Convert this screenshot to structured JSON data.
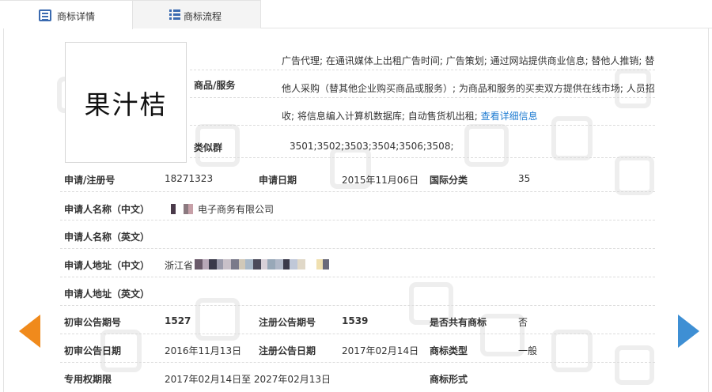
{
  "tabs": [
    {
      "label": "商标详情",
      "active": true
    },
    {
      "label": "商标流程",
      "active": false
    }
  ],
  "trademark": {
    "name": "果汁桔"
  },
  "goods_services": {
    "label": "商品/服务",
    "text": "广告代理; 在通讯媒体上出租广告时间; 广告策划; 通过网站提供商业信息; 替他人推销; 替他人采购（替其他企业购买商品或服务）; 为商品和服务的买卖双方提供在线市场; 人员招收; 将信息编入计算机数据库; 自动售货机出租;",
    "more_link": "查看详细信息"
  },
  "similar_group": {
    "label": "类似群",
    "value": "3501;3502;3503;3504;3506;3508;"
  },
  "fields": {
    "reg_no_label": "申请/注册号",
    "reg_no": "18271323",
    "apply_date_label": "申请日期",
    "apply_date": "2015年11月06日",
    "intl_class_label": "国际分类",
    "intl_class": "35",
    "applicant_cn_label": "申请人名称（中文）",
    "applicant_cn": "电子商务有限公司",
    "applicant_en_label": "申请人名称（英文）",
    "address_cn_label": "申请人地址（中文）",
    "address_cn": "浙江省",
    "address_en_label": "申请人地址（英文）",
    "prelim_no_label": "初审公告期号",
    "prelim_no": "1527",
    "reg_pub_no_label": "注册公告期号",
    "reg_pub_no": "1539",
    "shared_label": "是否共有商标",
    "shared": "否",
    "prelim_date_label": "初审公告日期",
    "prelim_date": "2016年11月13日",
    "reg_pub_date_label": "注册公告日期",
    "reg_pub_date": "2017年02月14日",
    "tm_type_label": "商标类型",
    "tm_type": "一般",
    "exclusive_label": "专用权期限",
    "exclusive": "2017年02月14日至 2027年02月13日",
    "tm_form_label": "商标形式"
  },
  "colors": {
    "link": "#1e7bd1",
    "prev_arrow": "#f08a1c",
    "next_arrow": "#3e8fd4"
  }
}
